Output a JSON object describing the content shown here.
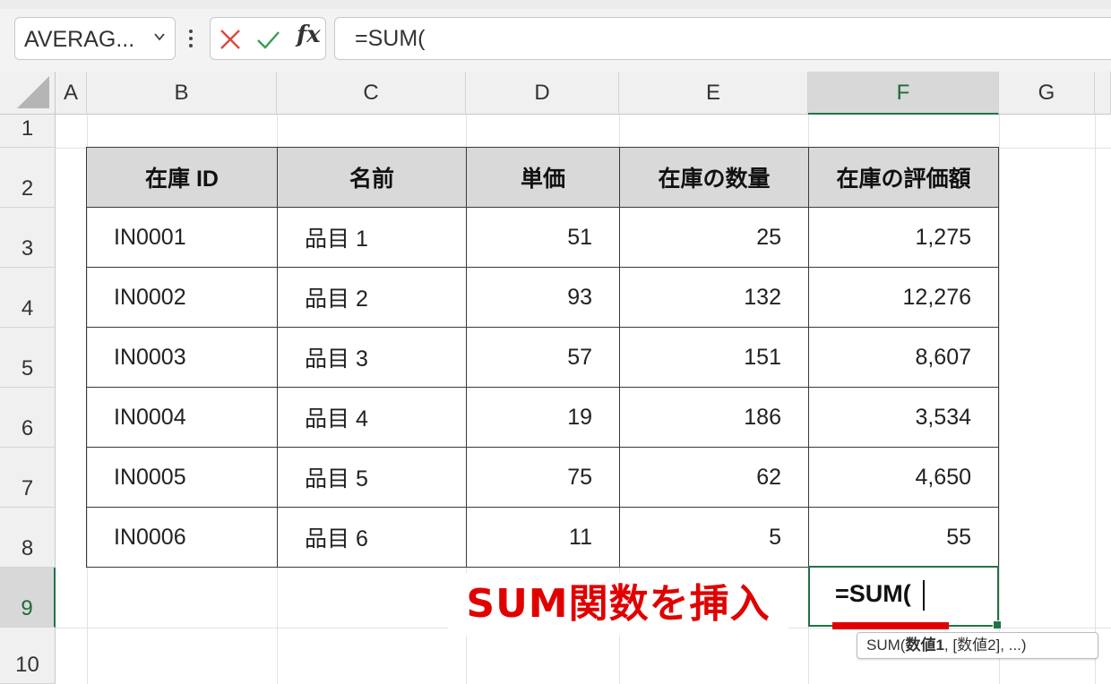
{
  "formula_bar": {
    "name_box": "AVERAG...",
    "fx_label": "fx",
    "formula": "=SUM("
  },
  "columns": [
    "A",
    "B",
    "C",
    "D",
    "E",
    "F",
    "G"
  ],
  "rows": [
    "1",
    "2",
    "3",
    "4",
    "5",
    "6",
    "7",
    "8",
    "9",
    "10"
  ],
  "table": {
    "headers": [
      "在庫 ID",
      "名前",
      "単価",
      "在庫の数量",
      "在庫の評価額"
    ],
    "rows": [
      [
        "IN0001",
        "品目 1",
        "51",
        "25",
        "1,275"
      ],
      [
        "IN0002",
        "品目 2",
        "93",
        "132",
        "12,276"
      ],
      [
        "IN0003",
        "品目 3",
        "57",
        "151",
        "8,607"
      ],
      [
        "IN0004",
        "品目 4",
        "19",
        "186",
        "3,534"
      ],
      [
        "IN0005",
        "品目 5",
        "75",
        "62",
        "4,650"
      ],
      [
        "IN0006",
        "品目 6",
        "11",
        "5",
        "55"
      ]
    ]
  },
  "active_cell": {
    "ref": "F9",
    "content": "=SUM("
  },
  "callout": "SUM関数を挿入",
  "tooltip": {
    "func": "SUM(",
    "arg1": "数値1",
    "rest": ", [数値2], ...)"
  },
  "colors": {
    "accent_green": "#217346",
    "callout_red": "#e10000",
    "header_gray": "#d9d9d9"
  },
  "icons": [
    "chevron-down-icon",
    "more-vert-icon",
    "cancel-x-icon",
    "confirm-check-icon",
    "select-all-triangle-icon"
  ]
}
